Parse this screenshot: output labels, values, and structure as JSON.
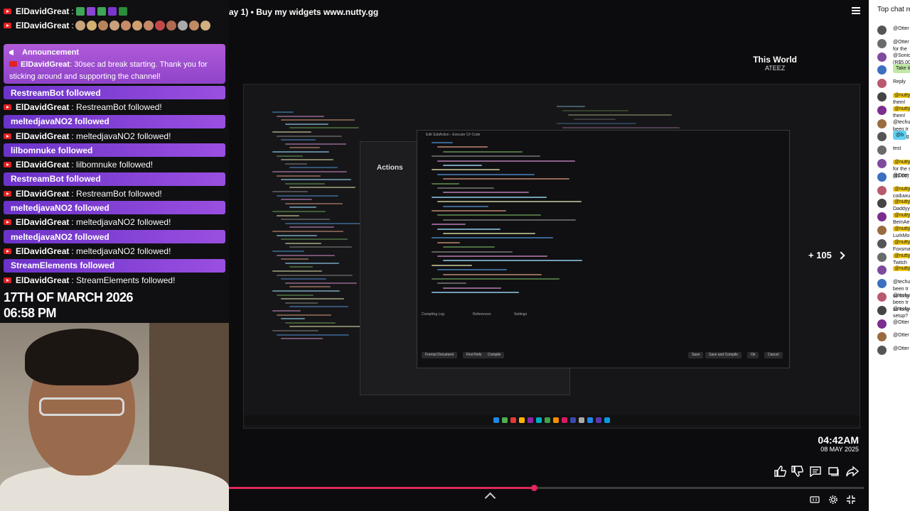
{
  "overlay": {
    "chat": [
      {
        "kind": "msg",
        "user": "ElDavidGreat",
        "sep": ":",
        "text": "",
        "badges": [
          "#3ea559",
          "#8b44d6",
          "#3ea559",
          "#7b35cf",
          "#2c8c3a"
        ]
      },
      {
        "kind": "msg",
        "user": "ElDavidGreat",
        "sep": ":",
        "text": "",
        "emotes": [
          "#c9a47a",
          "#d2b070",
          "#b9845b",
          "#caa07a",
          "#c98a6a",
          "#d0a070",
          "#c38a68",
          "#c24848",
          "#b06a50",
          "#aaa",
          "#c08a60",
          "#d0b080"
        ]
      }
    ],
    "announcement": {
      "label": "Announcement",
      "user": "ElDavidGreat",
      "text": ": 30sec ad break starting. Thank you for sticking around and supporting the channel!"
    },
    "follows": [
      {
        "bar": "RestreamBot followed",
        "user": "ElDavidGreat",
        "msg": ": RestreamBot followed!"
      },
      {
        "bar": "meltedjavaNO2 followed",
        "user": "ElDavidGreat",
        "msg": ": meltedjavaNO2 followed!"
      },
      {
        "bar": "lilbomnuke followed",
        "user": "ElDavidGreat",
        "msg": ": lilbomnuke followed!"
      },
      {
        "bar": "RestreamBot followed",
        "user": "ElDavidGreat",
        "msg": ": RestreamBot followed!"
      },
      {
        "bar": "meltedjavaNO2 followed",
        "user": "ElDavidGreat",
        "msg": ": meltedjavaNO2 followed!"
      },
      {
        "bar": "meltedjavaNO2 followed",
        "user": "ElDavidGreat",
        "msg": ": meltedjavaNO2 followed!"
      },
      {
        "bar": "StreamElements followed",
        "user": "ElDavidGreat",
        "msg": ": StreamElements followed!"
      }
    ],
    "date_line1": "17TH OF MARCH 2026",
    "date_line2": "06:58 PM"
  },
  "video": {
    "title": "ay 1) • Buy my widgets www.nutty.gg",
    "now_playing": {
      "song": "This World",
      "artist": "ATEEZ"
    },
    "screen": {
      "actions_title": "Actions",
      "dialog_title": "Edit SubAction - Execute C# Code",
      "tab_compiling_log": "Compiling Log",
      "tab_references": "References",
      "tab_settings": "Settings",
      "btn_format": "Format Document",
      "btn_find_refs": "Find Refs",
      "btn_compile": "Compile",
      "btn_save": "Save",
      "btn_save_compile": "Save and Compile",
      "btn_ok": "Ok",
      "btn_cancel": "Cancel"
    },
    "plus_count": "+ 105",
    "clock": {
      "time": "04:42AM",
      "date": "08 MAY 2025"
    },
    "progress_fraction": 0.48,
    "icons": [
      "like-icon",
      "dislike-icon",
      "comment-icon",
      "share-list-icon",
      "share-icon",
      "captions-icon",
      "settings-icon",
      "fullscreen-exit-icon"
    ]
  },
  "right_chat": {
    "header": "Top chat re",
    "rows": [
      {
        "text": "@Otter",
        "tag": false
      },
      {
        "text": "@Otter",
        "tag": false
      },
      {
        "text": "@Sonic",
        "tag": false
      },
      {
        "text": "Take it th",
        "tag": false,
        "bubble": "green"
      },
      {
        "text": "Reply",
        "tag": false
      },
      {
        "text": "@nutty",
        "tag": true
      },
      {
        "text": "@nutty",
        "tag": true
      },
      {
        "text": "@techu",
        "tag": false
      },
      {
        "text": "@b",
        "tag": false,
        "bubble": "blue"
      },
      {
        "text": "test",
        "tag": false
      },
      {
        "text": "@nutty",
        "tag": true
      },
      {
        "text": "@Otter",
        "tag": false
      },
      {
        "text": "@nutty",
        "tag": true
      },
      {
        "text": "@nutty",
        "tag": true
      },
      {
        "text": "@nutty",
        "tag": true
      },
      {
        "text": "@nutty",
        "tag": true
      },
      {
        "text": "@nutty",
        "tag": true
      },
      {
        "text": "@nutty",
        "tag": true
      },
      {
        "text": "@nutty",
        "tag": true
      },
      {
        "text": "@techu",
        "tag": false
      },
      {
        "text": "@techu",
        "tag": false
      },
      {
        "text": "@techu",
        "tag": false
      },
      {
        "text": "@Otter",
        "tag": false
      },
      {
        "text": "@Otter",
        "tag": false
      },
      {
        "text": "@Otter",
        "tag": false
      }
    ],
    "sub_lines": {
      "1": "for the",
      "2": "(R$5.00",
      "5": "them!",
      "6": "them!",
      "7": "been tr / so long",
      "10": "for the s / ($2.00)",
      "12": "coduwu / total!",
      "13": "Daddyy / subs in",
      "14": "BernAe / total!",
      "15": "LurkMo / total!",
      "16": "Foxsma / total!",
      "17": "Twitch / Subscri",
      "19": "been tr / so long",
      "20": "been tr / so long",
      "21": "setup?"
    }
  }
}
